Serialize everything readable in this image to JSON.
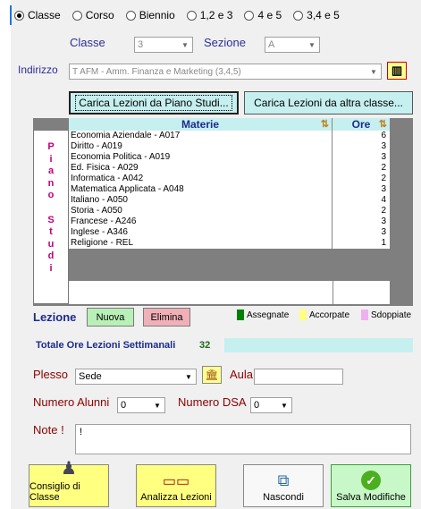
{
  "radios": [
    {
      "label": "Classe",
      "selected": true
    },
    {
      "label": "Corso",
      "selected": false
    },
    {
      "label": "Biennio",
      "selected": false
    },
    {
      "label": "1,2 e 3",
      "selected": false
    },
    {
      "label": "4 e 5",
      "selected": false
    },
    {
      "label": "3,4 e 5",
      "selected": false
    }
  ],
  "selectors": {
    "classe_label": "Classe",
    "classe_value": "3",
    "sezione_label": "Sezione",
    "sezione_value": "A",
    "indirizzo_label": "Indirizzo",
    "indirizzo_value": "T AFM - Amm. Finanza e Marketing (3,4,5)"
  },
  "load_buttons": {
    "piano_studi": "Carica Lezioni da Piano Studi...",
    "altra_classe": "Carica Lezioni da altra classe..."
  },
  "table": {
    "header_materie": "Materie",
    "header_ore": "Ore",
    "side_letters": [
      "P",
      "i",
      "a",
      "n",
      "o",
      "",
      "S",
      "t",
      "u",
      "d",
      "i"
    ],
    "rows": [
      {
        "materia": "Economia Aziendale - A017",
        "ore": "6"
      },
      {
        "materia": "Diritto - A019",
        "ore": "3"
      },
      {
        "materia": "Economia Politica - A019",
        "ore": "3"
      },
      {
        "materia": "Ed. Fisica - A029",
        "ore": "2"
      },
      {
        "materia": "Informatica - A042",
        "ore": "2"
      },
      {
        "materia": "Matematica Applicata - A048",
        "ore": "3"
      },
      {
        "materia": "Italiano - A050",
        "ore": "4"
      },
      {
        "materia": "Storia - A050",
        "ore": "2"
      },
      {
        "materia": "Francese - A246",
        "ore": "3"
      },
      {
        "materia": "Inglese - A346",
        "ore": "3"
      },
      {
        "materia": "Religione - REL",
        "ore": "1"
      }
    ]
  },
  "lezione": {
    "label": "Lezione",
    "nuova": "Nuova",
    "elimina": "Elimina",
    "legend": [
      {
        "label": "Assegnate",
        "color": "#008000"
      },
      {
        "label": "Accorpate",
        "color": "#ffff80"
      },
      {
        "label": "Sdoppiate",
        "color": "#f0b0f0"
      }
    ]
  },
  "totale": {
    "label": "Totale Ore Lezioni Settimanali",
    "value": "32"
  },
  "form": {
    "plesso_label": "Plesso",
    "plesso_value": "Sede",
    "aula_label": "Aula",
    "aula_value": "",
    "alunni_label": "Numero Alunni",
    "alunni_value": "0",
    "dsa_label": "Numero DSA",
    "dsa_value": "0",
    "note_label": "Note !",
    "note_value": "!"
  },
  "bottom_buttons": {
    "consiglio": "Consiglio di Classe",
    "analizza": "Analizza Lezioni",
    "nascondi": "Nascondi",
    "salva": "Salva Modifiche"
  },
  "colors": {
    "accent_cyan": "#c6efef",
    "nuova_bg": "#b8f0b8",
    "elimina_bg": "#f0b0b8",
    "yellow_btn": "#ffff80",
    "green_btn": "#c8f8c8"
  }
}
